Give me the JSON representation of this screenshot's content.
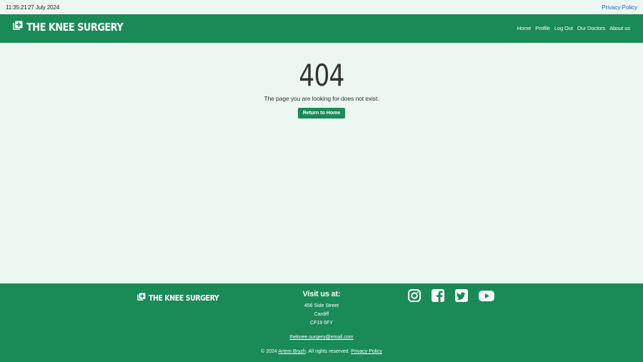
{
  "topbar": {
    "time": "11:35:21",
    "date": "27 July 2024",
    "privacy_link": "Privacy Policy"
  },
  "header": {
    "brand": "THE KNEE SURGERY",
    "brand_icon": "clinic-medical-icon",
    "nav": [
      "Home",
      "Profile",
      "Log Out",
      "Our Doctors",
      "About us"
    ]
  },
  "error_page": {
    "code": "404",
    "message": "The page you are looking for does not exist.",
    "button": "Return to Home"
  },
  "footer": {
    "brand": "THE KNEE SURGERY",
    "visit_heading": "Visit us at:",
    "address": [
      "456 Side Street",
      "Cardiff",
      "CF19 6FY"
    ],
    "email": "theknee.surgery@email.com",
    "copyright_prefix": "© 2024",
    "author": "Artem Bryzh",
    "rights": ". All rights reserved.",
    "privacy_link": "Privacy Policy",
    "social_icons": [
      "instagram-icon",
      "facebook-icon",
      "twitter-icon",
      "youtube-icon"
    ]
  },
  "colors": {
    "brand_green": "#1a8a57",
    "background": "#ecf7f1",
    "link_blue": "#1b5fe0"
  }
}
